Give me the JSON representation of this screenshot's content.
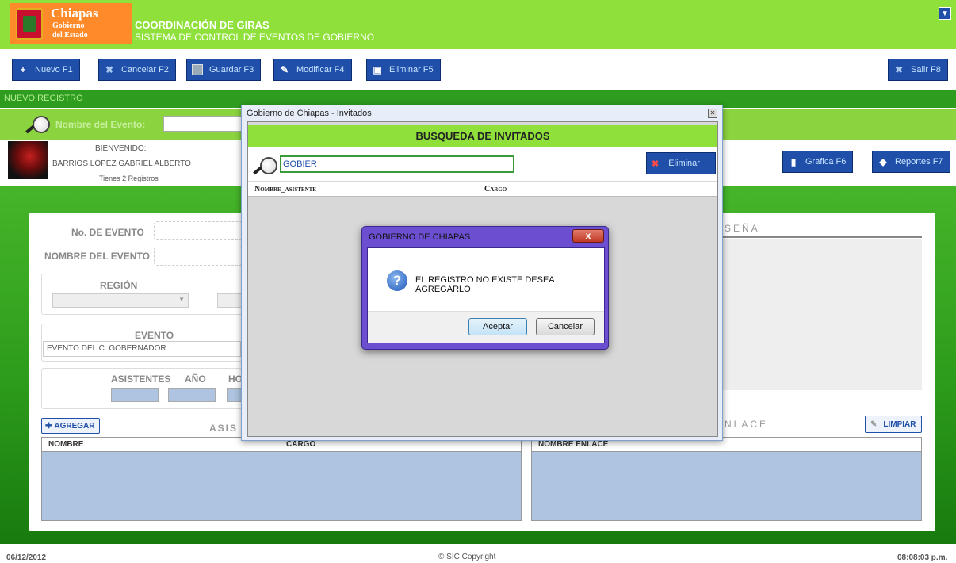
{
  "header": {
    "logo_line1": "Chiapas",
    "logo_line2": "Gobierno",
    "logo_line3": "del Estado",
    "title": "COORDINACIÓN DE GIRAS",
    "subtitle": "SISTEMA DE CONTROL DE EVENTOS DE GOBIERNO",
    "collapse_icon": "chevron-down-icon"
  },
  "toolbar": {
    "nuevo": "Nuevo F1",
    "cancelar": "Cancelar F2",
    "guardar": "Guardar F3",
    "modificar": "Modificar F4",
    "eliminar": "Eliminar F5",
    "salir": "Salir F8"
  },
  "nuevo_registro": "NUEVO REGISTRO",
  "search": {
    "label": "Nombre del Evento:",
    "value": ""
  },
  "user": {
    "welcome": "BIENVENIDO:",
    "name": "BARRIOS LÓPEZ GABRIEL ALBERTO",
    "registros": "Tienes 2 Registros"
  },
  "actions": {
    "grafica": "Grafica F6",
    "reportes": "Reportes F7"
  },
  "form": {
    "no_evento_label": "No. DE EVENTO",
    "nombre_evento_label": "NOMBRE DEL EVENTO",
    "region_label": "REGIÓN",
    "evento_label": "EVENTO",
    "evento_value": "EVENTO DEL C. GOBERNADOR",
    "asistentes_label": "ASISTENTES",
    "anio_label": "AÑO",
    "hora_label": "HO",
    "resena_label": "SEÑA",
    "agregar": "AGREGAR",
    "asis_label": "ASIS",
    "enlace_label": "NLACE",
    "limpiar": "LIMPIAR",
    "table1_cols": [
      "NOMBRE",
      "CARGO"
    ],
    "table2_cols": [
      "NOMBRE ENLACE"
    ]
  },
  "footer": {
    "date": "06/12/2012",
    "copyright": "© SIC Copyright",
    "time": "08:08:03 p.m."
  },
  "modal": {
    "title": "Gobierno de Chiapas - Invitados",
    "heading": "BUSQUEDA DE INVITADOS",
    "search_value": "GOBIER",
    "eliminar": "Eliminar",
    "columns": [
      "Nombre_asistente",
      "Cargo"
    ]
  },
  "msgbox": {
    "title": "GOBIERNO DE CHIAPAS",
    "message": "EL REGISTRO NO EXISTE DESEA AGREGARLO",
    "aceptar": "Aceptar",
    "cancelar": "Cancelar"
  },
  "colors": {
    "header_green": "#8fe03a",
    "dark_green": "#2e9d1f",
    "button_blue": "#1f4fa8",
    "logo_orange": "#ff8a2a"
  }
}
